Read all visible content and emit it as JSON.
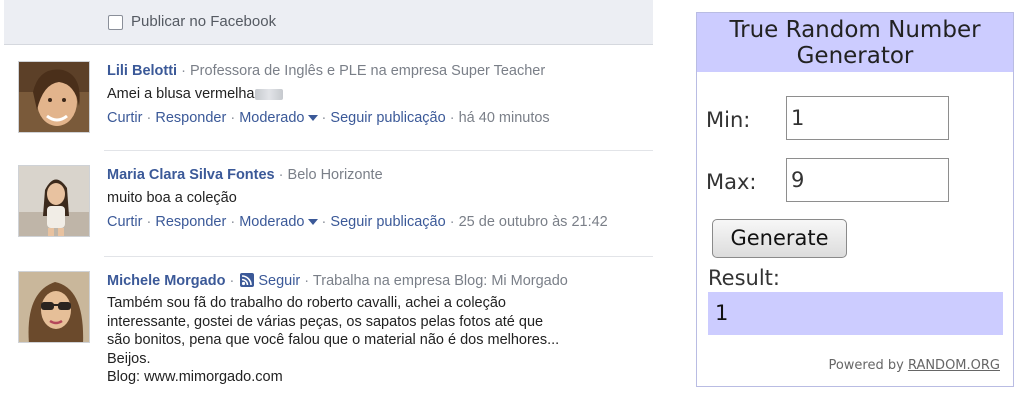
{
  "facebook": {
    "publish_checkbox_label": "Publicar no Facebook",
    "separator": "·",
    "comments": [
      {
        "name": "Lili Belotti",
        "description": "Professora de Inglês e PLE na empresa Super Teacher",
        "text": "Amei a blusa vermelha",
        "actions": {
          "like": "Curtir",
          "reply": "Responder",
          "moderated": "Moderado",
          "follow": "Seguir publicação"
        },
        "time": "há 40 minutos"
      },
      {
        "name": "Maria Clara Silva Fontes",
        "description": "Belo Horizonte",
        "text": "muito boa a coleção",
        "actions": {
          "like": "Curtir",
          "reply": "Responder",
          "moderated": "Moderado",
          "follow": "Seguir publicação"
        },
        "time": "25 de outubro às 21:42"
      },
      {
        "name": "Michele Morgado",
        "follow_label": "Seguir",
        "description": "Trabalha na empresa Blog: Mi Morgado",
        "text": "Também sou fã do trabalho do roberto cavalli, achei a coleção\ninteressante, gostei de várias peças, os sapatos pelas fotos até que\nsão bonitos, pena que você falou que o material não é dos melhores...\nBeijos.\nBlog: www.mimorgado.com"
      }
    ]
  },
  "rng": {
    "title": "True Random Number Generator",
    "min_label": "Min:",
    "min_value": "1",
    "max_label": "Max:",
    "max_value": "9",
    "generate_label": "Generate",
    "result_label": "Result:",
    "result_value": "1",
    "powered_by": "Powered by",
    "powered_link": "RANDOM.ORG",
    "colors": {
      "title_bg": "#ccccff",
      "result_bg": "#ccccff",
      "border": "#b9bce3"
    }
  }
}
